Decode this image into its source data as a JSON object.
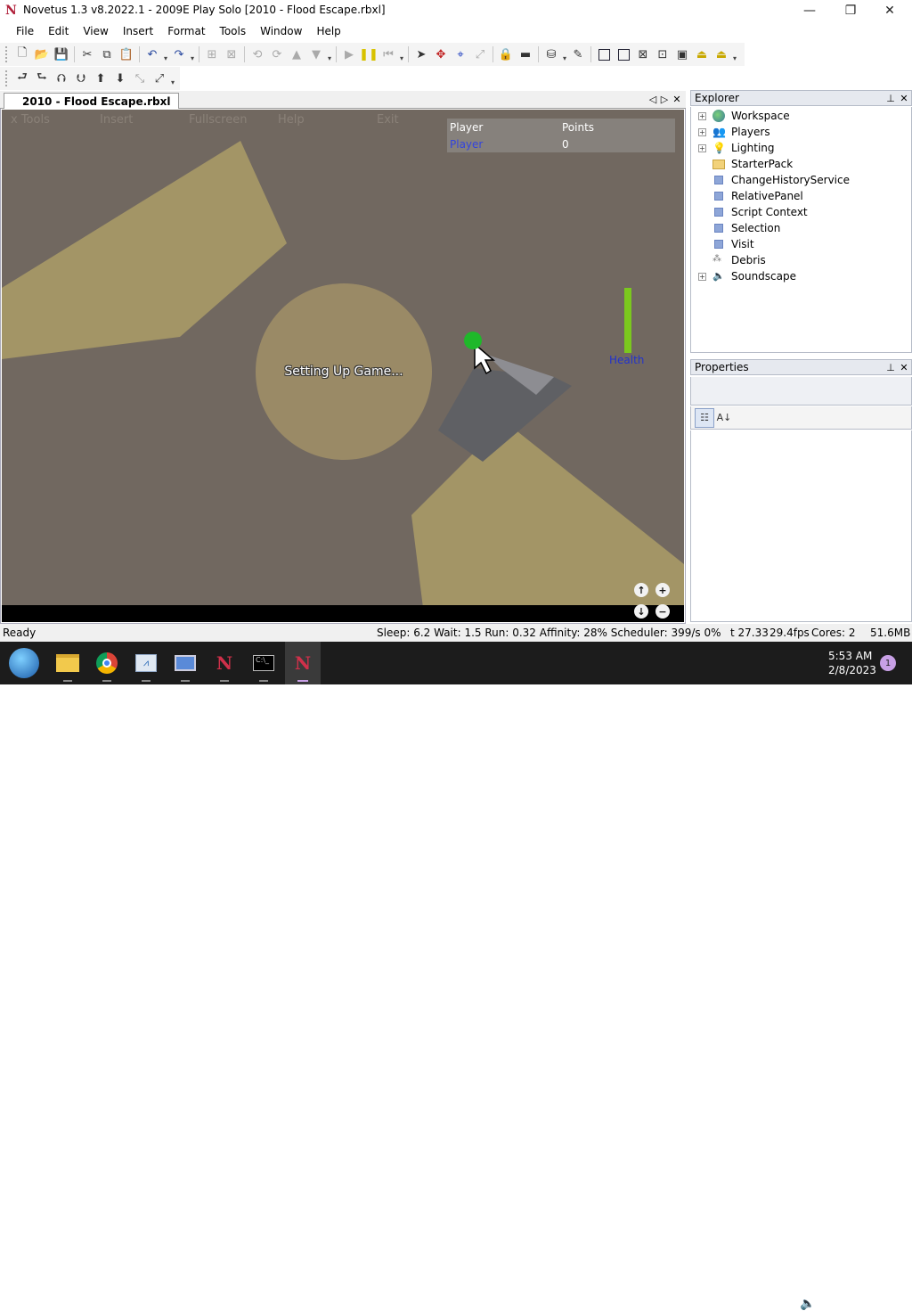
{
  "window": {
    "title": "Novetus 1.3 v8.2022.1 - 2009E Play Solo [2010 - Flood Escape.rbxl]",
    "minimize": "—",
    "maximize": "❐",
    "close": "✕"
  },
  "menu": [
    "File",
    "Edit",
    "View",
    "Insert",
    "Format",
    "Tools",
    "Window",
    "Help"
  ],
  "document": {
    "tab_label": "2010 - Flood Escape.rbxl"
  },
  "game": {
    "menu": [
      "x Tools",
      "Insert",
      "Fullscreen",
      "Help",
      "Exit"
    ],
    "scoreboard": {
      "col_player": "Player",
      "col_points": "Points",
      "player_name": "Player",
      "player_points": "0"
    },
    "loading_text": "Setting Up Game...",
    "health_label": "Health",
    "health_fraction": 1.0
  },
  "explorer": {
    "title": "Explorer",
    "items": [
      {
        "label": "Workspace",
        "expandable": true,
        "icon": "globe-icon"
      },
      {
        "label": "Players",
        "expandable": true,
        "icon": "players-icon"
      },
      {
        "label": "Lighting",
        "expandable": true,
        "icon": "lightbulb-icon"
      },
      {
        "label": "StarterPack",
        "expandable": false,
        "icon": "folder-icon"
      },
      {
        "label": "ChangeHistoryService",
        "expandable": false,
        "icon": "service-icon"
      },
      {
        "label": "RelativePanel",
        "expandable": false,
        "icon": "service-icon"
      },
      {
        "label": "Script Context",
        "expandable": false,
        "icon": "service-icon"
      },
      {
        "label": "Selection",
        "expandable": false,
        "icon": "service-icon"
      },
      {
        "label": "Visit",
        "expandable": false,
        "icon": "service-icon"
      },
      {
        "label": "Debris",
        "expandable": false,
        "icon": "debris-icon"
      },
      {
        "label": "Soundscape",
        "expandable": true,
        "icon": "speaker-icon"
      }
    ]
  },
  "properties": {
    "title": "Properties"
  },
  "status": {
    "left": "Ready",
    "perf": "Sleep: 6.2 Wait: 1.5 Run: 0.32 Affinity: 28% Scheduler: 399/s 0%",
    "time": "t 27.33",
    "fps": "29.4fps",
    "cores": "Cores: 2",
    "memory": "51.6MB"
  },
  "taskbar": {
    "time": "5:53 AM",
    "date": "2/8/2023",
    "notifications": "1"
  },
  "colors": {
    "viewport_bg": "#716860",
    "shape": "#a39566",
    "health": "#7bc81e",
    "health_label": "#2233cc",
    "player_link": "#3344dd",
    "cursor_dot": "#1fb82a"
  }
}
